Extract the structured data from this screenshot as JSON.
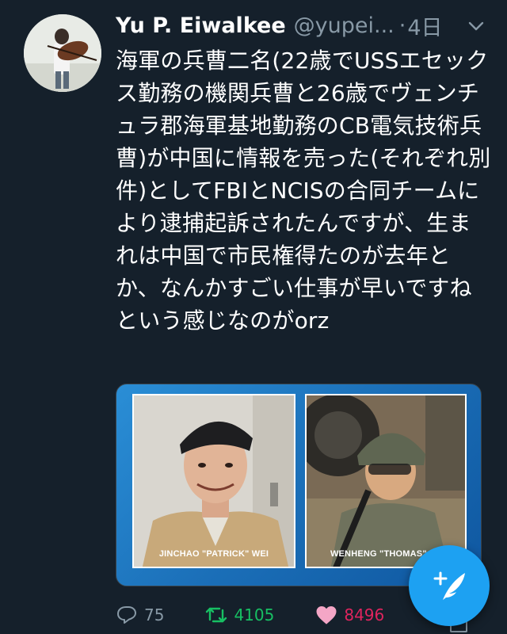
{
  "tweet": {
    "author_name": "Yu P. Eiwalkee",
    "author_handle": "@yupei...",
    "separator": "·",
    "time": "4日",
    "text": "海軍の兵曹二名(22歳でUSSエセックス勤務の機関兵曹と26歳でヴェンチュラ郡海軍基地勤務のCB電気技術兵曹)が中国に情報を売った(それぞれ別件)としてFBIとNCISの合同チームにより逮捕起訴されたんですが、生まれは中国で市民権得たのが去年とか、なんかすごい仕事が早いですねという感じなのがorz",
    "media": {
      "left_caption": "JINCHAO \"PATRICK\" WEI",
      "right_caption": "WENHENG \"THOMAS\" ZH"
    },
    "actions": {
      "reply_count": "75",
      "retweet_count": "4105",
      "like_count": "8496"
    }
  },
  "icons": {
    "avatar": "avatar-violinist",
    "menu": "chevron-down-icon",
    "reply": "reply-icon",
    "retweet": "retweet-icon",
    "like": "heart-icon",
    "compose": "compose-tweet-icon"
  },
  "colors": {
    "background": "#15202b",
    "secondary_text": "#8899a6",
    "retweet": "#17bf63",
    "like": "#e0245e",
    "accent": "#1da1f2"
  }
}
